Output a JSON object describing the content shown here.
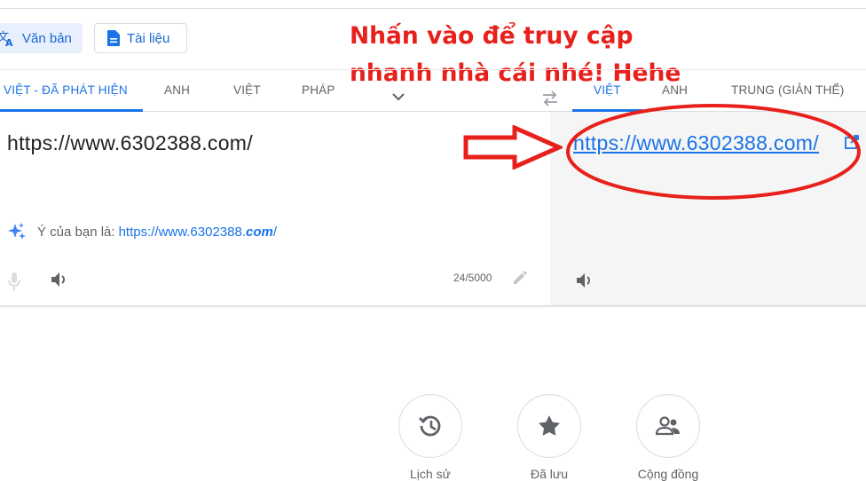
{
  "modes": {
    "text_label": "Văn bản",
    "docs_label": "Tài liệu"
  },
  "annotation": {
    "text": "Nhấn vào để truy cập\nnhanh nhà cái nhé! Hehe",
    "color": "#e8201b"
  },
  "source_langs": {
    "detect": "VIỆT - ĐÃ PHÁT HIỆN",
    "en": "ANH",
    "vi": "VIỆT",
    "fr": "PHÁP"
  },
  "target_langs": {
    "vi": "VIỆT",
    "en": "ANH",
    "zh": "TRUNG (GIẢN THỂ)"
  },
  "source": {
    "text": "https://www.6302388.com/",
    "suggestion_prefix": "Ý của bạn là:",
    "suggestion_start": "https://www.6302388.",
    "suggestion_bold": "com",
    "suggestion_end": "/",
    "char_count": "24/5000"
  },
  "target": {
    "text": "https://www.6302388.com/"
  },
  "features": {
    "history": "Lịch sử",
    "saved": "Đã lưu",
    "community": "Cộng đồng"
  },
  "icons": {
    "text-mode": "translate-icon",
    "docs-mode": "document-icon",
    "swap": "swap-icon",
    "more-langs": "chevron-down-icon",
    "clear": "close-icon",
    "suggest": "sparkle-icon",
    "mic": "mic-icon",
    "listen": "speaker-icon",
    "edit": "pencil-icon",
    "open-link": "external-link-icon",
    "history": "history-icon",
    "saved": "star-icon",
    "community": "people-icon"
  },
  "colors": {
    "accent": "#1a73e8",
    "annotation_red": "#e8201b",
    "target_panel_bg": "#f5f5f5"
  }
}
